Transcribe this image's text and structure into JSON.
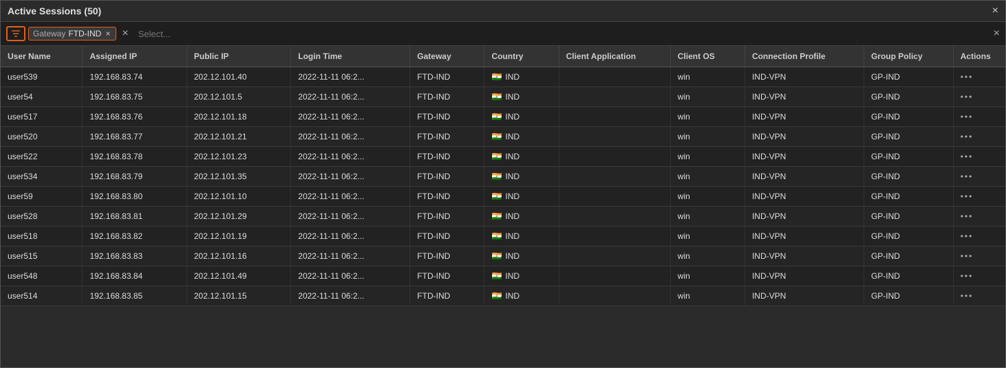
{
  "window": {
    "title": "Active Sessions (50)",
    "close_label": "×"
  },
  "filter": {
    "filter_icon": "⊟",
    "tag_label": "Gateway",
    "tag_value": "FTD-IND",
    "tag_close": "×",
    "select_placeholder": "Select...",
    "clear_label": "×"
  },
  "table": {
    "columns": [
      {
        "key": "username",
        "label": "User Name"
      },
      {
        "key": "assignedip",
        "label": "Assigned IP"
      },
      {
        "key": "publicip",
        "label": "Public IP"
      },
      {
        "key": "logintime",
        "label": "Login Time"
      },
      {
        "key": "gateway",
        "label": "Gateway"
      },
      {
        "key": "country",
        "label": "Country"
      },
      {
        "key": "clientapp",
        "label": "Client Application"
      },
      {
        "key": "clientos",
        "label": "Client OS"
      },
      {
        "key": "connprofile",
        "label": "Connection Profile"
      },
      {
        "key": "grouppolicy",
        "label": "Group Policy"
      },
      {
        "key": "actions",
        "label": "Actions"
      }
    ],
    "rows": [
      {
        "username": "user539",
        "assignedip": "192.168.83.74",
        "publicip": "202.12.101.40",
        "logintime": "2022-11-11 06:2...",
        "gateway": "FTD-IND",
        "country": "IND",
        "clientapp": "",
        "clientos": "win",
        "connprofile": "IND-VPN",
        "grouppolicy": "GP-IND"
      },
      {
        "username": "user54",
        "assignedip": "192.168.83.75",
        "publicip": "202.12.101.5",
        "logintime": "2022-11-11 06:2...",
        "gateway": "FTD-IND",
        "country": "IND",
        "clientapp": "",
        "clientos": "win",
        "connprofile": "IND-VPN",
        "grouppolicy": "GP-IND"
      },
      {
        "username": "user517",
        "assignedip": "192.168.83.76",
        "publicip": "202.12.101.18",
        "logintime": "2022-11-11 06:2...",
        "gateway": "FTD-IND",
        "country": "IND",
        "clientapp": "",
        "clientos": "win",
        "connprofile": "IND-VPN",
        "grouppolicy": "GP-IND"
      },
      {
        "username": "user520",
        "assignedip": "192.168.83.77",
        "publicip": "202.12.101.21",
        "logintime": "2022-11-11 06:2...",
        "gateway": "FTD-IND",
        "country": "IND",
        "clientapp": "",
        "clientos": "win",
        "connprofile": "IND-VPN",
        "grouppolicy": "GP-IND"
      },
      {
        "username": "user522",
        "assignedip": "192.168.83.78",
        "publicip": "202.12.101.23",
        "logintime": "2022-11-11 06:2...",
        "gateway": "FTD-IND",
        "country": "IND",
        "clientapp": "",
        "clientos": "win",
        "connprofile": "IND-VPN",
        "grouppolicy": "GP-IND"
      },
      {
        "username": "user534",
        "assignedip": "192.168.83.79",
        "publicip": "202.12.101.35",
        "logintime": "2022-11-11 06:2...",
        "gateway": "FTD-IND",
        "country": "IND",
        "clientapp": "",
        "clientos": "win",
        "connprofile": "IND-VPN",
        "grouppolicy": "GP-IND"
      },
      {
        "username": "user59",
        "assignedip": "192.168.83.80",
        "publicip": "202.12.101.10",
        "logintime": "2022-11-11 06:2...",
        "gateway": "FTD-IND",
        "country": "IND",
        "clientapp": "",
        "clientos": "win",
        "connprofile": "IND-VPN",
        "grouppolicy": "GP-IND"
      },
      {
        "username": "user528",
        "assignedip": "192.168.83.81",
        "publicip": "202.12.101.29",
        "logintime": "2022-11-11 06:2...",
        "gateway": "FTD-IND",
        "country": "IND",
        "clientapp": "",
        "clientos": "win",
        "connprofile": "IND-VPN",
        "grouppolicy": "GP-IND"
      },
      {
        "username": "user518",
        "assignedip": "192.168.83.82",
        "publicip": "202.12.101.19",
        "logintime": "2022-11-11 06:2...",
        "gateway": "FTD-IND",
        "country": "IND",
        "clientapp": "",
        "clientos": "win",
        "connprofile": "IND-VPN",
        "grouppolicy": "GP-IND"
      },
      {
        "username": "user515",
        "assignedip": "192.168.83.83",
        "publicip": "202.12.101.16",
        "logintime": "2022-11-11 06:2...",
        "gateway": "FTD-IND",
        "country": "IND",
        "clientapp": "",
        "clientos": "win",
        "connprofile": "IND-VPN",
        "grouppolicy": "GP-IND"
      },
      {
        "username": "user548",
        "assignedip": "192.168.83.84",
        "publicip": "202.12.101.49",
        "logintime": "2022-11-11 06:2...",
        "gateway": "FTD-IND",
        "country": "IND",
        "clientapp": "",
        "clientos": "win",
        "connprofile": "IND-VPN",
        "grouppolicy": "GP-IND"
      },
      {
        "username": "user514",
        "assignedip": "192.168.83.85",
        "publicip": "202.12.101.15",
        "logintime": "2022-11-11 06:2...",
        "gateway": "FTD-IND",
        "country": "IND",
        "clientapp": "",
        "clientos": "win",
        "connprofile": "IND-VPN",
        "grouppolicy": "GP-IND"
      }
    ]
  },
  "icons": {
    "india_flag": "🇮🇳",
    "actions_dots": "•••"
  }
}
